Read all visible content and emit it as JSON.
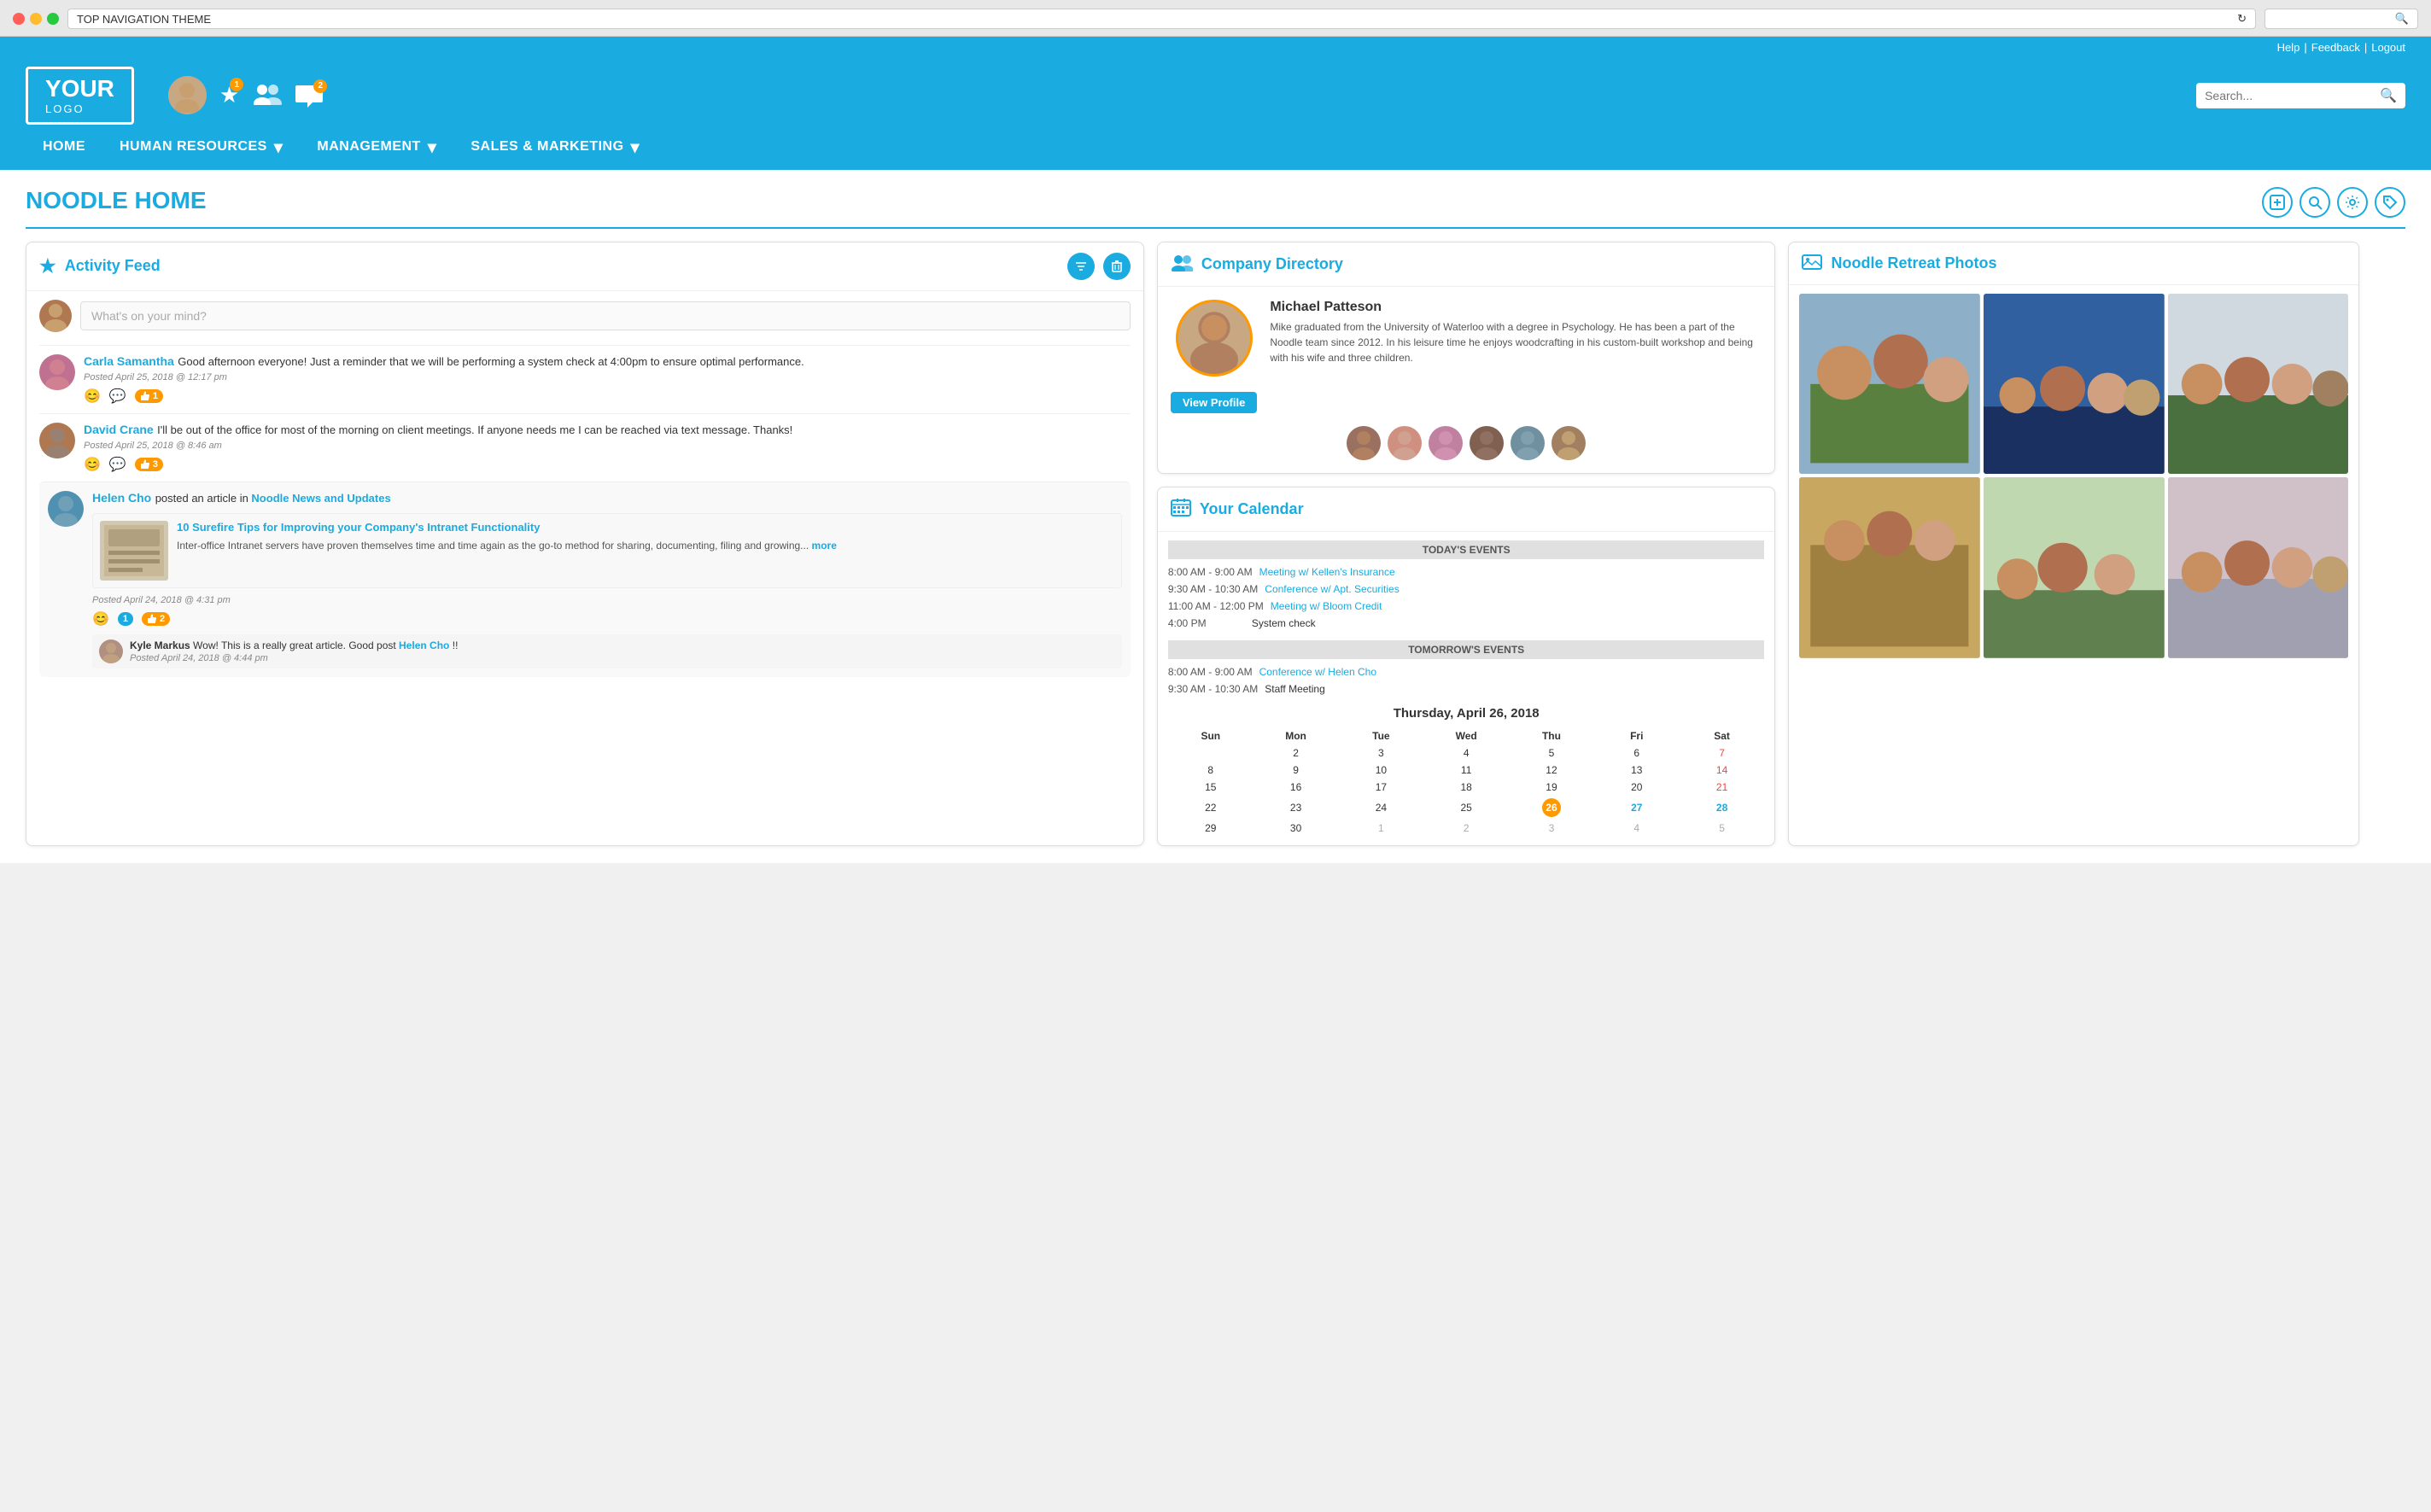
{
  "browser": {
    "address": "TOP NAVIGATION THEME",
    "refresh_icon": "↻",
    "search_icon": "🔍"
  },
  "utility_bar": {
    "help": "Help",
    "feedback": "Feedback",
    "logout": "Logout"
  },
  "header": {
    "logo_line1": "YOUR",
    "logo_line2": "LOGO",
    "search_placeholder": "Search...",
    "star_badge": "1",
    "chat_badge": "2"
  },
  "nav": {
    "items": [
      {
        "label": "HOME",
        "has_dropdown": false
      },
      {
        "label": "HUMAN RESOURCES",
        "has_dropdown": true
      },
      {
        "label": "MANAGEMENT",
        "has_dropdown": true
      },
      {
        "label": "SALES & MARKETING",
        "has_dropdown": true
      }
    ]
  },
  "page": {
    "title": "NOODLE HOME",
    "toolbar_icons": [
      "copy-icon",
      "search-icon",
      "gear-icon",
      "tag-icon"
    ]
  },
  "activity_feed": {
    "title": "Activity Feed",
    "what_placeholder": "What's on your mind?",
    "posts": [
      {
        "author": "Carla Samantha",
        "text": "Good afternoon everyone! Just a reminder that we will be performing a system check at 4:00pm to ensure optimal performance.",
        "meta": "Posted April 25, 2018 @ 12:17 pm",
        "like_count": "1"
      },
      {
        "author": "David Crane",
        "text": "I'll be out of the office for most of the morning on client meetings. If anyone needs me I can be reached via text message. Thanks!",
        "meta": "Posted April 25, 2018 @ 8:46 am",
        "like_count": "3"
      },
      {
        "author": "Helen Cho",
        "post_type": "article",
        "post_text_pre": "posted an article in",
        "channel": "Noodle News and Updates",
        "article_title": "10 Surefire Tips for Improving your Company's Intranet Functionality",
        "article_desc": "Inter-office Intranet servers have proven themselves time and time again as the go-to method for sharing, documenting, filing and growing...",
        "article_more": "more",
        "meta": "Posted April 24, 2018 @ 4:31 pm",
        "like_count": "2",
        "comment_count": "1",
        "comment": {
          "author": "Kyle Markus",
          "text_pre": "Wow! This is a really great article. Good post",
          "mention": "Helen Cho",
          "text_post": "!!",
          "meta": "Posted April 24, 2018 @ 4:44 pm"
        }
      }
    ]
  },
  "company_directory": {
    "title": "Company Directory",
    "featured": {
      "name": "Michael Patteson",
      "desc": "Mike graduated from the University of Waterloo with a degree in Psychology. He has been a part of the Noodle team since 2012. In his leisure time he enjoys woodcrafting in his custom-built workshop and being with his wife and three children."
    },
    "view_profile": "View Profile",
    "staff_count": 6
  },
  "calendar": {
    "title": "Your Calendar",
    "today_header": "TODAY'S EVENTS",
    "tomorrow_header": "TOMORROW'S EVENTS",
    "today_events": [
      {
        "time": "8:00 AM - 9:00 AM",
        "label": "Meeting w/ Kellen's Insurance",
        "is_link": true
      },
      {
        "time": "9:30 AM - 10:30 AM",
        "label": "Conference w/ Apt. Securities",
        "is_link": true
      },
      {
        "time": "11:00 AM - 12:00 PM",
        "label": "Meeting w/ Bloom Credit",
        "is_link": true
      },
      {
        "time": "4:00 PM",
        "label": "System check",
        "is_link": false
      }
    ],
    "tomorrow_events": [
      {
        "time": "8:00 AM - 9:00 AM",
        "label": "Conference w/ Helen Cho",
        "is_link": true
      },
      {
        "time": "9:30 AM - 10:30 AM",
        "label": "Staff Meeting",
        "is_link": false
      }
    ],
    "mini_cal": {
      "title": "Thursday, April 26, 2018",
      "headers": [
        "Sun",
        "Mon",
        "Tue",
        "Wed",
        "Thu",
        "Fri",
        "Sat"
      ],
      "weeks": [
        [
          "",
          "2",
          "3",
          "4",
          "5",
          "6",
          "7"
        ],
        [
          "8",
          "9",
          "10",
          "11",
          "12",
          "13",
          "14"
        ],
        [
          "15",
          "16",
          "17",
          "18",
          "19",
          "20",
          "21"
        ],
        [
          "22",
          "23",
          "24",
          "25",
          "26",
          "27",
          "28"
        ],
        [
          "29",
          "30",
          "1",
          "2",
          "3",
          "4",
          "5"
        ]
      ],
      "today_date": "26",
      "link_dates": [
        "27",
        "28"
      ],
      "special_row4": [
        false,
        false,
        false,
        false,
        true,
        true,
        true
      ],
      "row5_grayed": [
        false,
        false,
        true,
        true,
        true,
        true,
        true
      ]
    }
  },
  "photos": {
    "title": "Noodle Retreat Photos",
    "count": 6,
    "colors": [
      "#8db0c8",
      "#3060a0",
      "#d0d8e0",
      "#c8a860",
      "#c0c8d0",
      "#d0c0c8"
    ]
  }
}
